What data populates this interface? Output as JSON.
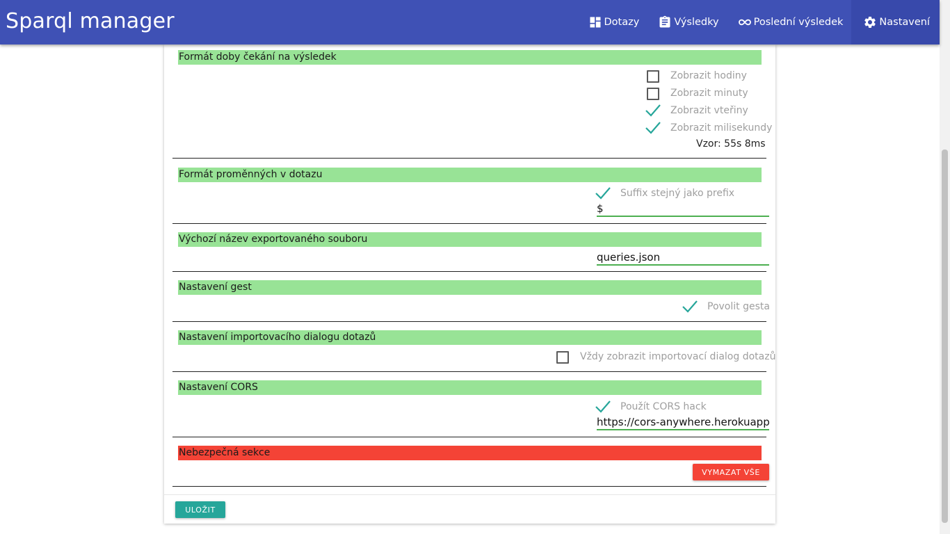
{
  "app": {
    "title": "Sparql manager"
  },
  "nav": {
    "queries": {
      "label": "Dotazy",
      "icon": "dashboard-icon"
    },
    "results": {
      "label": "Výsledky",
      "icon": "clipboard-icon"
    },
    "last_result": {
      "label": "Poslední výsledek",
      "icon": "infinity-icon"
    },
    "settings": {
      "label": "Nastavení",
      "icon": "gear-icon"
    }
  },
  "sections": {
    "wait_format": {
      "title": "Formát doby čekání na výsledek",
      "show_hours": {
        "label": "Zobrazit hodiny",
        "checked": false
      },
      "show_minutes": {
        "label": "Zobrazit minuty",
        "checked": false
      },
      "show_seconds": {
        "label": "Zobrazit vteřiny",
        "checked": true
      },
      "show_millis": {
        "label": "Zobrazit milisekundy",
        "checked": true
      },
      "sample": "Vzor: 55s 8ms"
    },
    "variables": {
      "title": "Formát proměnných v dotazu",
      "suffix_same": {
        "label": "Suffix stejný jako prefix",
        "checked": true
      },
      "prefix_value": "$"
    },
    "export": {
      "title": "Výchozí název exportovaného souboru",
      "filename": "queries.json"
    },
    "gestures": {
      "title": "Nastavení gest",
      "allow": {
        "label": "Povolit gesta",
        "checked": true
      }
    },
    "import_dialog": {
      "title": "Nastavení importovacího dialogu dotazů",
      "always_show": {
        "label": "Vždy zobrazit importovací dialog dotazů",
        "checked": false
      }
    },
    "cors": {
      "title": "Nastavení CORS",
      "use_hack": {
        "label": "Použít CORS hack",
        "checked": true
      },
      "url": "https://cors-anywhere.herokuapp.com/"
    },
    "danger": {
      "title": "Nebezpečná sekce",
      "clear_all": "VYMAZAT VŠE"
    }
  },
  "footer": {
    "save": "ULOŽIT"
  },
  "colors": {
    "navbar": "#3f51b5",
    "section_header": "#98e396",
    "danger": "#f44336",
    "accent": "#26a69a"
  }
}
